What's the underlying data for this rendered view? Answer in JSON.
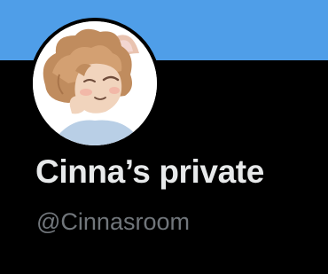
{
  "profile": {
    "display_name": "Cinna’s private",
    "handle": "@Cinnasroom",
    "avatar_icon": "profile-avatar-illustration"
  },
  "colors": {
    "banner": "#4f9ee8",
    "background": "#000000",
    "name_text": "#e7e9ea",
    "handle_text": "#71767b"
  }
}
